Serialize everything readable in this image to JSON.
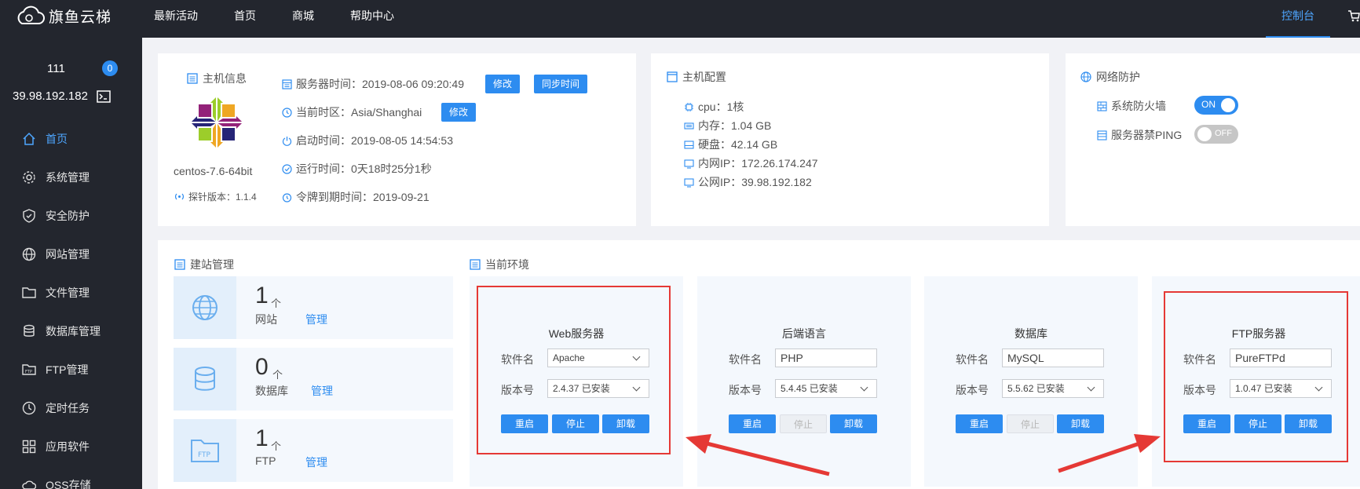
{
  "topbar": {
    "logo_text": "旗鱼云梯",
    "nav": [
      "最新活动",
      "首页",
      "商城",
      "帮助中心"
    ],
    "console": "控制台"
  },
  "sidebar": {
    "user_name": "111",
    "badge": "0",
    "ip": "39.98.192.182",
    "menu": [
      {
        "label": "首页",
        "icon": "home-icon"
      },
      {
        "label": "系统管理",
        "icon": "gear-icon"
      },
      {
        "label": "安全防护",
        "icon": "shield-icon"
      },
      {
        "label": "网站管理",
        "icon": "globe-icon"
      },
      {
        "label": "文件管理",
        "icon": "folder-icon"
      },
      {
        "label": "数据库管理",
        "icon": "database-icon"
      },
      {
        "label": "FTP管理",
        "icon": "ftp-icon"
      },
      {
        "label": "定时任务",
        "icon": "clock-icon"
      },
      {
        "label": "应用软件",
        "icon": "apps-icon"
      },
      {
        "label": "OSS存储",
        "icon": "cloud-icon"
      }
    ]
  },
  "host_info": {
    "title": "主机信息",
    "os": "centos-7.6-64bit",
    "probe_version": "探针版本：1.1.4",
    "server_time": "服务器时间：2019-08-06 09:20:49",
    "timezone": "当前时区：Asia/Shanghai",
    "boot_time": "启动时间：2019-08-05 14:54:53",
    "uptime": "运行时间：0天18时25分1秒",
    "token_expiry": "令牌到期时间：2019-09-21",
    "modify_label": "修改",
    "sync_label": "同步时间"
  },
  "host_config": {
    "title": "主机配置",
    "cpu": "cpu：1核",
    "memory": "内存：1.04 GB",
    "disk": "硬盘：42.14 GB",
    "private_ip": "内网IP：172.26.174.247",
    "public_ip": "公网IP：39.98.192.182"
  },
  "network_protection": {
    "title": "网络防护",
    "firewall_label": "系统防火墙",
    "firewall_state": "ON",
    "ping_label": "服务器禁PING",
    "ping_state": "OFF"
  },
  "site_management": {
    "title": "建站管理",
    "rows": [
      {
        "count": "1",
        "unit": "个",
        "label": "网站",
        "manage": "管理"
      },
      {
        "count": "0",
        "unit": "个",
        "label": "数据库",
        "manage": "管理"
      },
      {
        "count": "1",
        "unit": "个",
        "label": "FTP",
        "manage": "管理"
      }
    ]
  },
  "environment": {
    "title": "当前环境",
    "name_label": "软件名",
    "version_label": "版本号",
    "restart": "重启",
    "stop": "停止",
    "uninstall": "卸载",
    "cards": [
      {
        "title": "Web服务器",
        "name": "Apache",
        "version": "2.4.37 已安装"
      },
      {
        "title": "后端语言",
        "name": "PHP",
        "version": "5.4.45 已安装"
      },
      {
        "title": "数据库",
        "name": "MySQL",
        "version": "5.5.62 已安装"
      },
      {
        "title": "FTP服务器",
        "name": "PureFTPd",
        "version": "1.0.47 已安装"
      }
    ]
  },
  "colors": {
    "accent": "#2d8cf0",
    "annotation": "#e53935",
    "dark": "#23262e"
  }
}
